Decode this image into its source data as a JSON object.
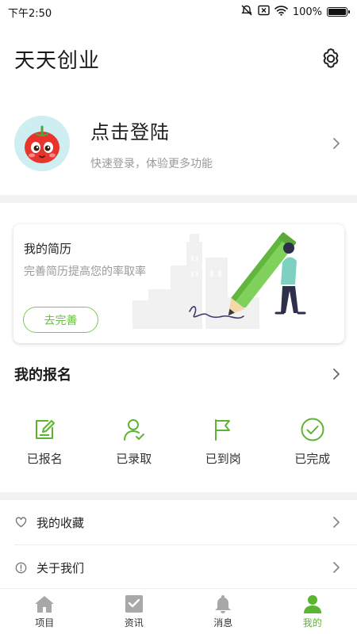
{
  "status_bar": {
    "time": "下午2:50",
    "battery": "100%",
    "battery_level": 1.0,
    "icons": [
      "alarm-off-icon",
      "sim-error-icon",
      "wifi-icon",
      "battery-icon"
    ]
  },
  "header": {
    "title": "天天创业",
    "settings_icon": "gear-icon"
  },
  "profile": {
    "title": "点击登陆",
    "subtitle": "快速登录，体验更多功能",
    "avatar_icon": "tomato-avatar-icon"
  },
  "resume": {
    "title": "我的简历",
    "subtitle": "完善简历提高您的率取率",
    "button_label": "去完善"
  },
  "signup": {
    "title": "我的报名",
    "items": [
      {
        "label": "已报名",
        "icon": "edit-note-icon"
      },
      {
        "label": "已录取",
        "icon": "user-check-icon"
      },
      {
        "label": "已到岗",
        "icon": "flag-icon"
      },
      {
        "label": "已完成",
        "icon": "check-circle-icon"
      }
    ]
  },
  "menu": [
    {
      "label": "我的收藏",
      "icon": "heart-icon"
    },
    {
      "label": "关于我们",
      "icon": "info-icon"
    }
  ],
  "tabs": [
    {
      "label": "项目",
      "icon": "home-icon",
      "active": false
    },
    {
      "label": "资讯",
      "icon": "news-icon",
      "active": false
    },
    {
      "label": "消息",
      "icon": "bell-icon",
      "active": false
    },
    {
      "label": "我的",
      "icon": "person-icon",
      "active": true
    }
  ],
  "colors": {
    "accent": "#5cb531",
    "button_border": "#7dc85c",
    "inactive_icon": "#a8a8a8",
    "separator": "#f2f2f2"
  }
}
